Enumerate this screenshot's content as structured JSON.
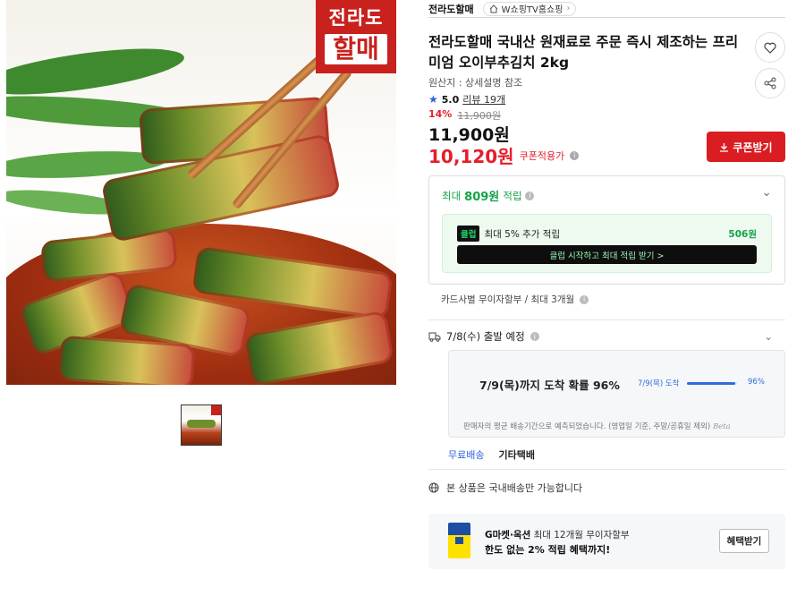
{
  "image": {
    "badge_line1": "전라도",
    "badge_line2": "할매"
  },
  "header": {
    "seller": "전라도할매",
    "channel": "W쇼핑TV홈쇼핑",
    "channel_icon": "home-icon"
  },
  "product": {
    "title": "전라도할매 국내산 원재료로 주문 즉시 제조하는 프리미엄 오이부추김치 2kg",
    "origin": "원산지 : 상세설명 참조",
    "rating": "5.0",
    "review_link": "리뷰 19개",
    "discount_pct": "14%",
    "original_price": "11,900원",
    "price": "11,900원",
    "coupon_price": "10,120원",
    "coupon_label": "쿠폰적용가",
    "coupon_button": "쿠폰받기"
  },
  "points": {
    "prefix": "최대",
    "amount": "809원",
    "suffix": "적립",
    "club_badge": "클럽",
    "club_text": "최대 5% 추가 적립",
    "club_amount": "506원",
    "club_button": "클럽 시작하고 최대 적립 받기  >"
  },
  "card": {
    "text": "카드사별 무이자할부 / 최대 3개월"
  },
  "shipping": {
    "departure": "7/8(수) 출발 예정",
    "arrival_main": "7/9(목)까지 도착 확률 96%",
    "arrival_bar_label": "7/9(목) 도착",
    "arrival_probability": 96,
    "arrival_bar_pct": "96%",
    "note": "판매자의 평균 배송기간으로 예측되었습니다. (영업일 기준, 주말/공휴일 제외)",
    "note_brand": "Beta",
    "free_shipping": "무료배송",
    "courier": "기타택배",
    "domestic": "본 상품은 국내배송만 가능합니다"
  },
  "promo": {
    "line1_bold": "G마켓·옥션",
    "line1_rest": "최대 12개월 무이자할부",
    "line2": "한도 없는 2% 적립 혜택까지!",
    "button": "혜택받기"
  },
  "colors": {
    "accent_red": "#e51e2a",
    "coupon_button": "#d91d22",
    "points_green": "#16a249",
    "link_blue": "#2d62d8"
  }
}
